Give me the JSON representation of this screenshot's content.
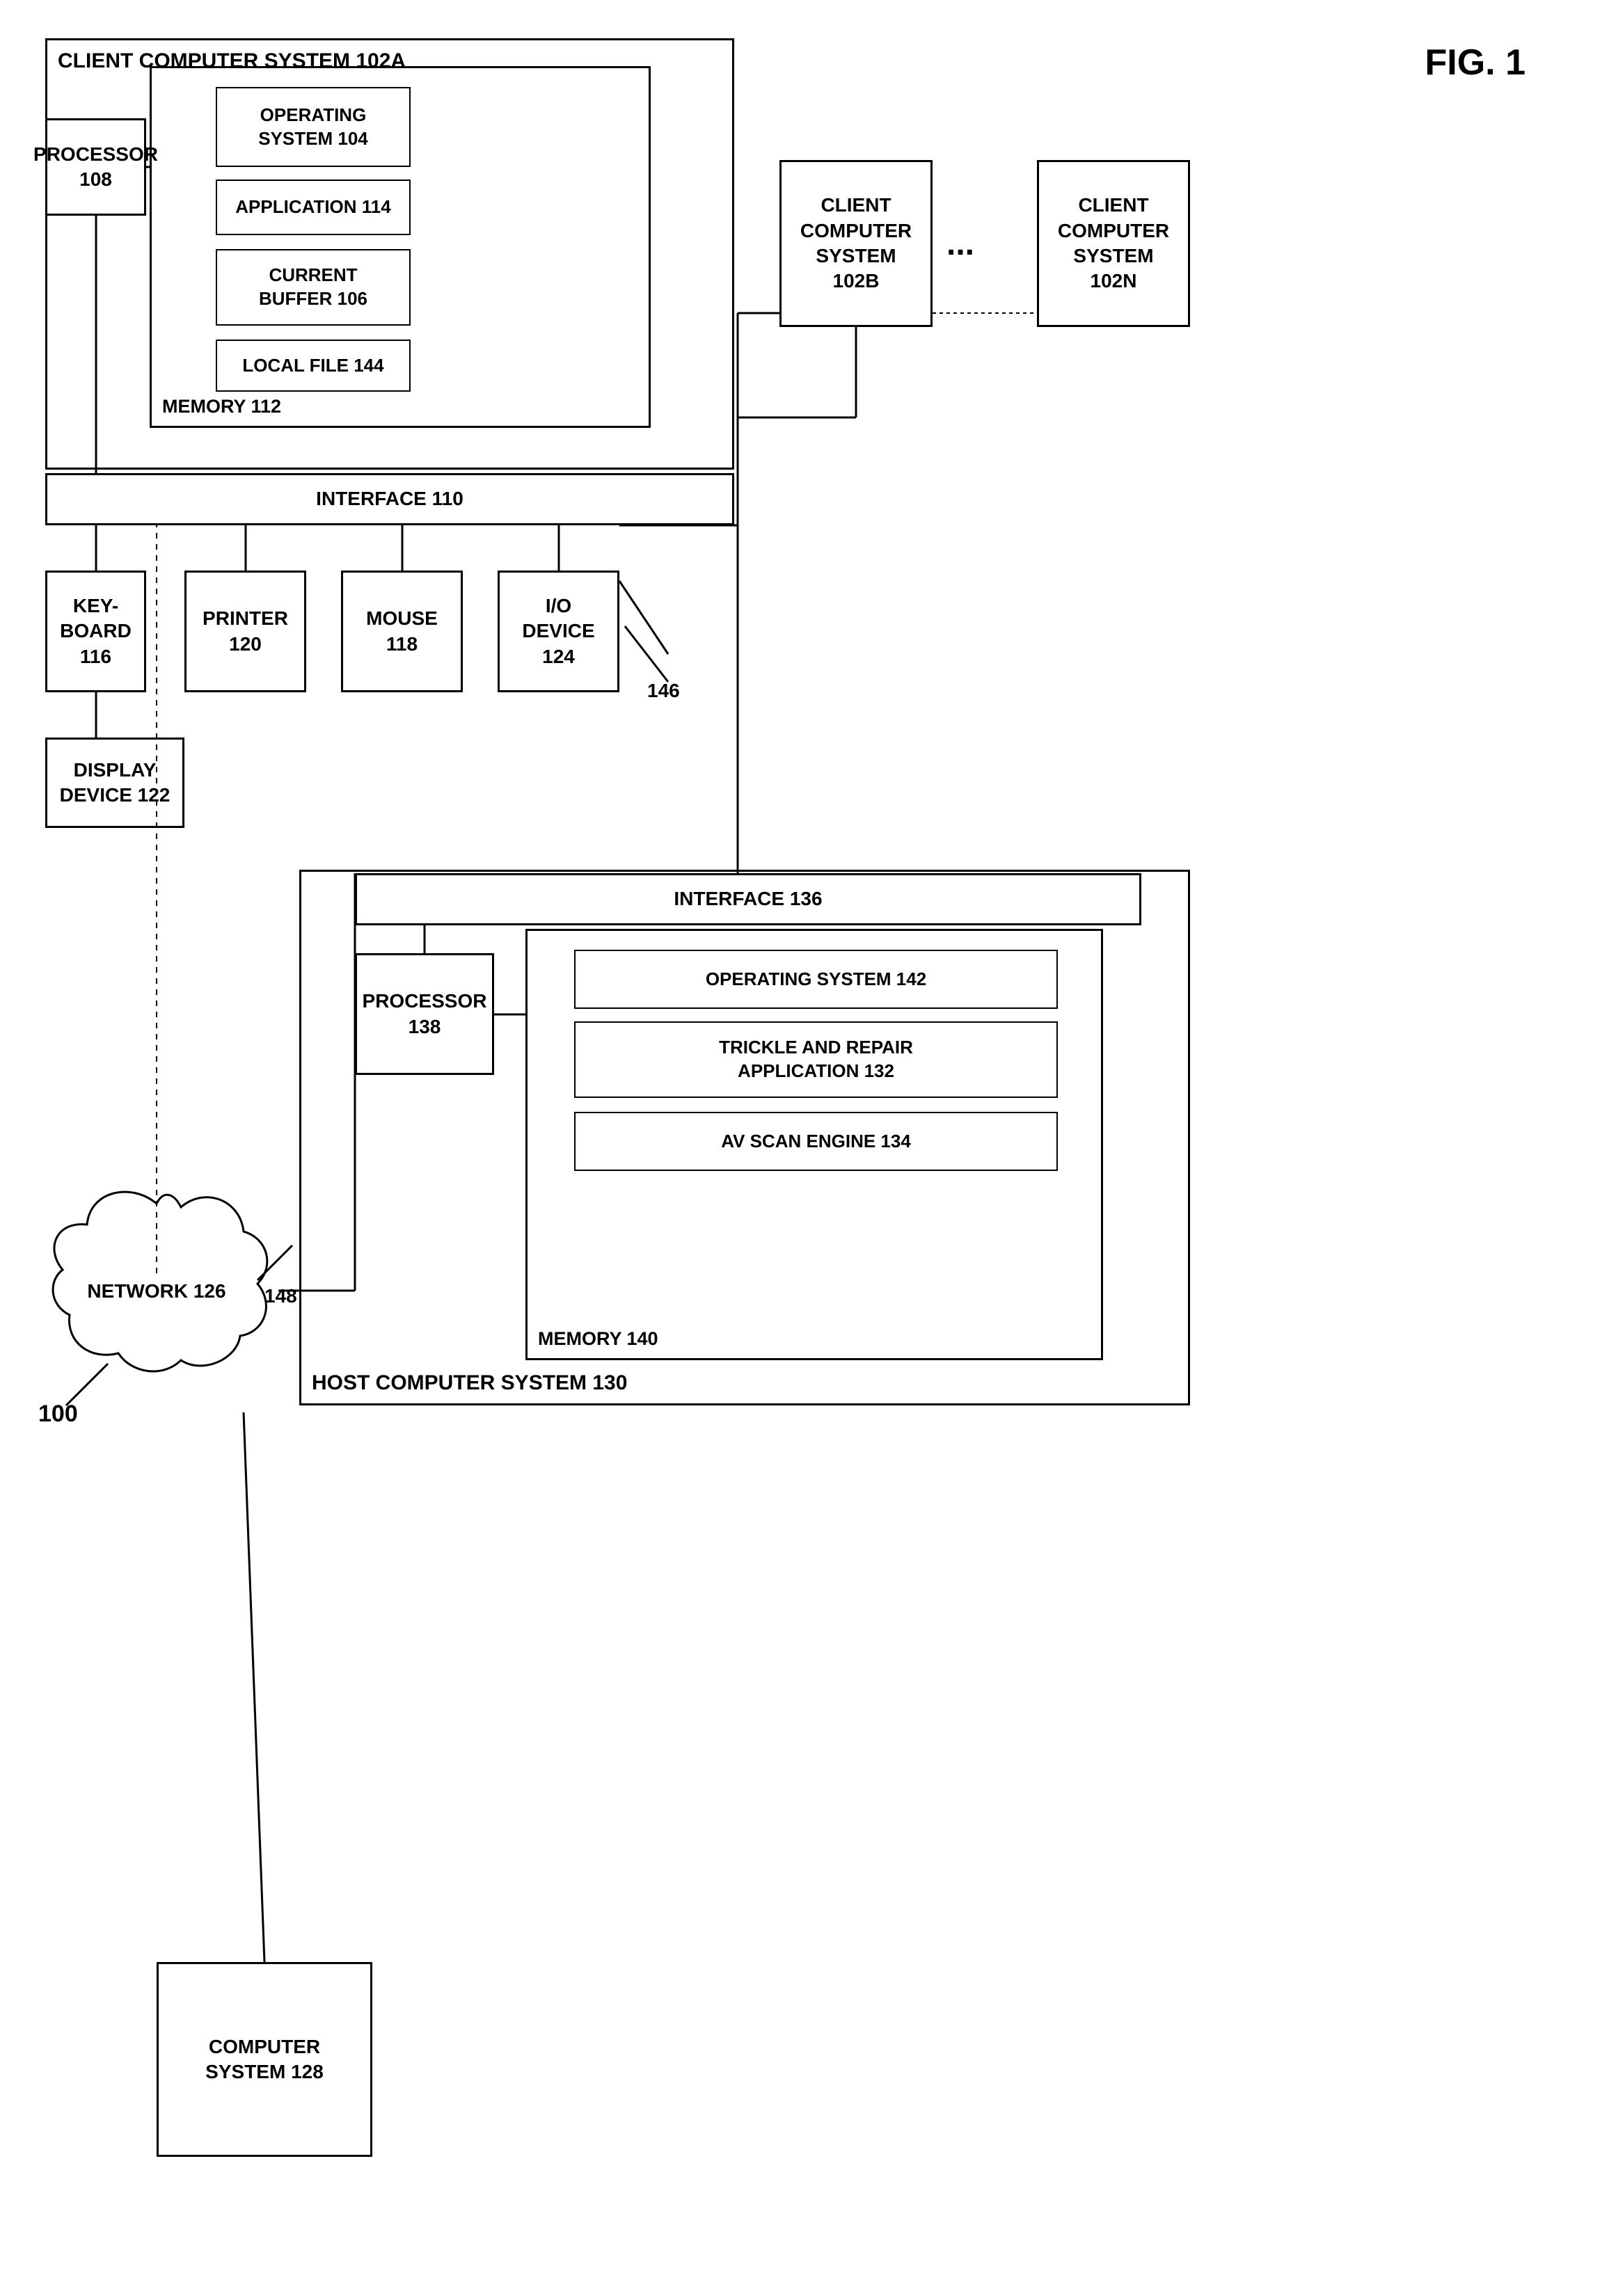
{
  "fig_label": "FIG. 1",
  "diagram_number": "100",
  "boxes": {
    "client_computer_system_102a": {
      "label": "CLIENT COMPUTER SYSTEM  102A",
      "id": "client-computer-system-102a"
    },
    "operating_system_104": {
      "label": "OPERATING\nSYSTEM  104",
      "id": "operating-system-104"
    },
    "application_114": {
      "label": "APPLICATION 114",
      "id": "application-114"
    },
    "current_buffer_106": {
      "label": "CURRENT\nBUFFER 106",
      "id": "current-buffer-106"
    },
    "local_file_144": {
      "label": "LOCAL FILE 144",
      "id": "local-file-144"
    },
    "memory_112": {
      "label": "MEMORY 112",
      "id": "memory-112"
    },
    "processor_108": {
      "label": "PROCESSOR\n108",
      "id": "processor-108"
    },
    "interface_110": {
      "label": "INTERFACE 110",
      "id": "interface-110"
    },
    "keyboard_116": {
      "label": "KEY-\nBOARD\n116",
      "id": "keyboard-116"
    },
    "printer_120": {
      "label": "PRINTER\n120",
      "id": "printer-120"
    },
    "mouse_118": {
      "label": "MOUSE\n118",
      "id": "mouse-118"
    },
    "io_device_124": {
      "label": "I/O\nDEVICE\n124",
      "id": "io-device-124"
    },
    "display_device_122": {
      "label": "DISPLAY\nDEVICE 122",
      "id": "display-device-122"
    },
    "client_computer_102b": {
      "label": "CLIENT\nCOMPUTER\nSYSTEM\n102B",
      "id": "client-computer-102b"
    },
    "client_computer_102n": {
      "label": "CLIENT\nCOMPUTER\nSYSTEM\n102N",
      "id": "client-computer-102n"
    },
    "dots": {
      "label": "...",
      "id": "dots"
    },
    "network_126": {
      "label": "NETWORK 126",
      "id": "network-126"
    },
    "host_computer_system_130": {
      "label": "HOST COMPUTER SYSTEM 130",
      "id": "host-computer-system-130"
    },
    "interface_136": {
      "label": "INTERFACE 136",
      "id": "interface-136"
    },
    "processor_138": {
      "label": "PROCESSOR\n138",
      "id": "processor-138"
    },
    "operating_system_142": {
      "label": "OPERATING SYSTEM 142",
      "id": "operating-system-142"
    },
    "trickle_repair_132": {
      "label": "TRICKLE AND REPAIR\nAPPLICATION 132",
      "id": "trickle-repair-132"
    },
    "av_scan_engine_134": {
      "label": "AV SCAN ENGINE   134",
      "id": "av-scan-engine-134"
    },
    "memory_140": {
      "label": "MEMORY 140",
      "id": "memory-140"
    },
    "computer_system_128": {
      "label": "COMPUTER\nSYSTEM 128",
      "id": "computer-system-128"
    },
    "label_146": "146",
    "label_148": "148",
    "label_100": "100"
  }
}
